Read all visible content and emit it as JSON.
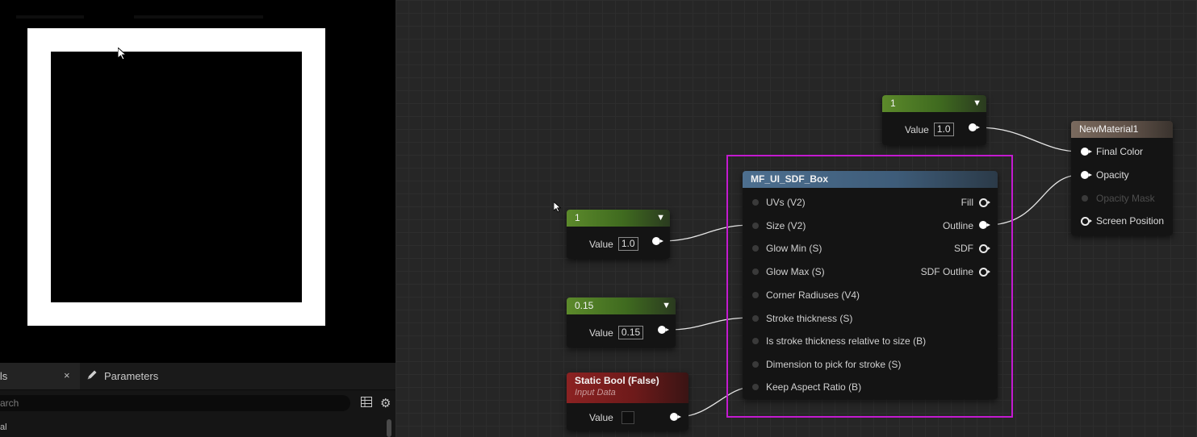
{
  "details_panel": {
    "details_tab_label": "ils",
    "close_glyph": "×",
    "parameters_tab_label": "Parameters",
    "search_placeholder": "arch",
    "first_row_label": "al"
  },
  "graph": {
    "constant_top": {
      "header": "1",
      "value_label": "Value",
      "value": "1.0"
    },
    "constant_size": {
      "header": "1",
      "value_label": "Value",
      "value": "1.0"
    },
    "constant_stroke": {
      "header": "0.15",
      "value_label": "Value",
      "value": "0.15"
    },
    "static_bool": {
      "title": "Static Bool (False)",
      "subtitle": "Input Data",
      "value_label": "Value",
      "checked": false
    },
    "sdf_box": {
      "title": "MF_UI_SDF_Box",
      "inputs": [
        "UVs (V2)",
        "Size (V2)",
        "Glow Min (S)",
        "Glow Max (S)",
        "Corner Radiuses (V4)",
        "Stroke thickness (S)",
        "Is stroke thickness relative to size (B)",
        "Dimension to pick for stroke (S)",
        "Keep Aspect Ratio (B)"
      ],
      "outputs": [
        "Fill",
        "Outline",
        "SDF",
        "SDF Outline"
      ]
    },
    "result": {
      "title": "NewMaterial1",
      "inputs": [
        "Final Color",
        "Opacity",
        "Opacity Mask",
        "Screen Position"
      ]
    }
  },
  "colors": {
    "selection": "#c31ad0",
    "constant_header": "#5c8a2b",
    "function_header": "#4d6f8f",
    "bool_header": "#8b2222",
    "result_header": "#7a6a5e"
  }
}
